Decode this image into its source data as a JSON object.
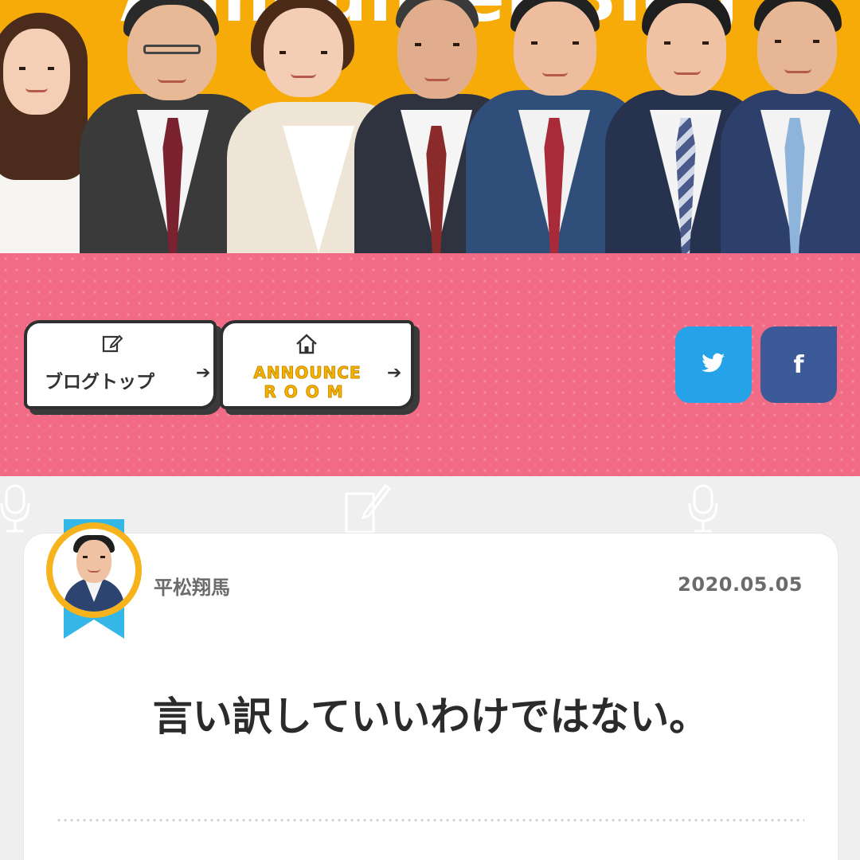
{
  "header": {
    "banner_title": "Announcer Blog"
  },
  "nav": {
    "blog_top_label": "ブログトップ",
    "announce_room_line1": "ANNOUNCE",
    "announce_room_line2": "ROOM",
    "arrow_glyph": "➔"
  },
  "social": {
    "twitter_glyph": "🐦",
    "facebook_glyph": "f"
  },
  "colors": {
    "banner": "#f7ab08",
    "band": "#f26b86",
    "twitter": "#26a3e8",
    "facebook": "#3d5a98",
    "ribbon": "#34b6e6",
    "avatar_ring": "#f6b31b"
  },
  "post": {
    "author": "平松翔馬",
    "date": "2020.05.05",
    "title": "言い訳していいわけではない。"
  }
}
